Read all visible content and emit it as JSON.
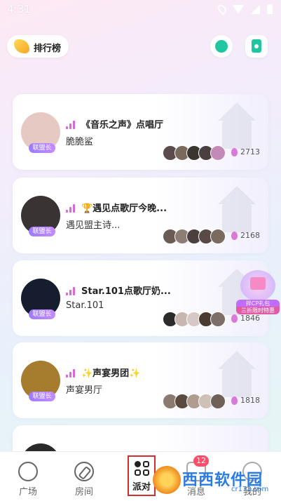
{
  "status_bar": {
    "time": "4:31"
  },
  "header": {
    "rank_label": "排行榜",
    "search_icon": "search-icon",
    "music_icon": "music-file-icon"
  },
  "rooms": [
    {
      "title": "《音乐之声》点唱厅",
      "host": "脆脆鲨",
      "badge": "联盟长",
      "heat": "2713",
      "avatar_color": "#e7c9c3",
      "members": [
        "#5a4c4c",
        "#7a6a5e",
        "#3b3530",
        "#4a4040",
        "#c48ab7"
      ]
    },
    {
      "title": "🏆遇见点歌厅今晚...",
      "host": "遇见盟主诗...",
      "badge": "联盟长",
      "heat": "2168",
      "avatar_color": "#3a3333",
      "members": [
        "#6b5b55",
        "#8d7d75",
        "#4b403d",
        "#5a4a45",
        "#7a6a60"
      ]
    },
    {
      "title": "Star.101点歌厅奶...",
      "host": "Star.101",
      "badge": "联盟长",
      "heat": "1846",
      "avatar_color": "#151d2e",
      "members": [
        "#2b2b2b",
        "#c8b7b0",
        "#d6c9c5",
        "#4a3a30",
        "#7d6e67"
      ]
    },
    {
      "title": "✨声宴男团✨",
      "host": "声宴男厅",
      "badge": "联盟长",
      "heat": "1818",
      "avatar_color": "#a67c2e",
      "members": [
        "#8a7a70",
        "#5a4a40",
        "#b09d90",
        "#cfc1b5",
        "#6f6058"
      ]
    }
  ],
  "promo": {
    "line1": "拌CP礼包",
    "line2": "三折限时特惠"
  },
  "tabbar": {
    "tabs": [
      {
        "label": "广场",
        "icon": "heart-icon"
      },
      {
        "label": "房间",
        "icon": "compass-icon"
      },
      {
        "label": "派对",
        "icon": "party-grid-icon"
      },
      {
        "label": "消息",
        "icon": "message-icon"
      },
      {
        "label": "我的",
        "icon": "profile-icon"
      }
    ],
    "message_badge": "12"
  },
  "watermark": {
    "main": "西西软件园",
    "sub": "cr173.com"
  }
}
